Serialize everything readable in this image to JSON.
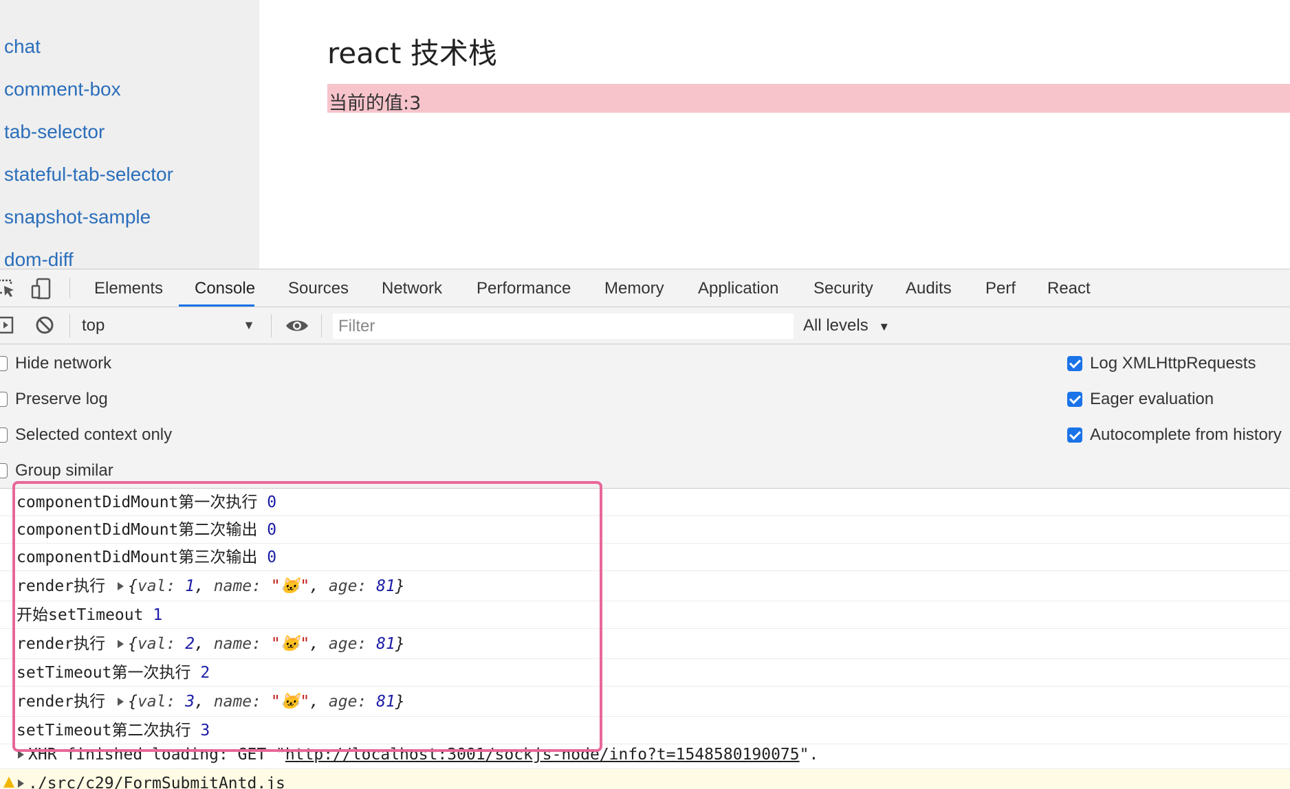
{
  "sidebar": {
    "links": [
      "chat",
      "comment-box",
      "tab-selector",
      "stateful-tab-selector",
      "snapshot-sample",
      "dom-diff"
    ]
  },
  "main": {
    "title": "react 技术栈",
    "value_text": "当前的值:3"
  },
  "devtools": {
    "tabs": [
      "Elements",
      "Console",
      "Sources",
      "Network",
      "Performance",
      "Memory",
      "Application",
      "Security",
      "Audits",
      "Perf",
      "React"
    ],
    "active_tab": "Console",
    "accent_color": "#1a73e8",
    "toolbar": {
      "context": "top",
      "filter_placeholder": "Filter",
      "levels": "All levels"
    },
    "settings_left": [
      {
        "label": "Hide network",
        "checked": false
      },
      {
        "label": "Preserve log",
        "checked": false
      },
      {
        "label": "Selected context only",
        "checked": false
      },
      {
        "label": "Group similar",
        "checked": false
      }
    ],
    "settings_right": [
      {
        "label": "Log XMLHttpRequests",
        "checked": true
      },
      {
        "label": "Eager evaluation",
        "checked": true
      },
      {
        "label": "Autocomplete from history",
        "checked": true
      }
    ]
  },
  "console": {
    "messages": [
      {
        "text": "componentDidMount第一次执行",
        "value": "0"
      },
      {
        "text": "componentDidMount第二次输出",
        "value": "0"
      },
      {
        "text": "componentDidMount第三次输出",
        "value": "0"
      },
      {
        "text": "render执行",
        "obj": {
          "val": "1",
          "name": "🐱",
          "age": "81"
        }
      },
      {
        "text": "开始setTimeout",
        "value": "1"
      },
      {
        "text": "render执行",
        "obj": {
          "val": "2",
          "name": "🐱",
          "age": "81"
        }
      },
      {
        "text": "setTimeout第一次执行",
        "value": "2"
      },
      {
        "text": "render执行",
        "obj": {
          "val": "3",
          "name": "🐱",
          "age": "81"
        }
      },
      {
        "text": "setTimeout第二次执行",
        "value": "3"
      }
    ],
    "xhr": {
      "prefix": "XHR finished loading: GET \"",
      "url": "http://localhost:3001/sockjs-node/info?t=1548580190075",
      "suffix": "\"."
    },
    "warning": {
      "text": "./src/c29/FormSubmitAntd.js"
    },
    "highlight_color": "#e8679a"
  }
}
